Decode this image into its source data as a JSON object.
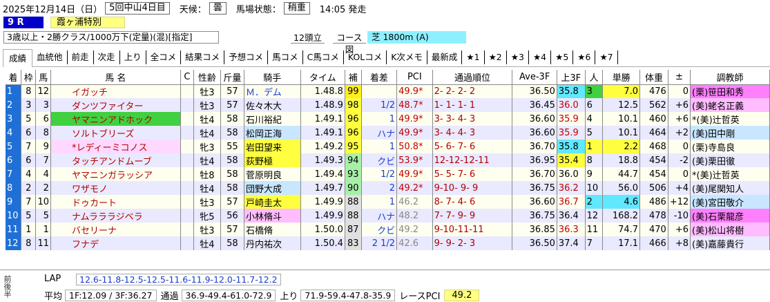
{
  "info": {
    "date": "2025年12月14日（日）",
    "meeting": "5回中山4日目",
    "weather_label": "天候：",
    "weather": "曇",
    "track_label": "馬場状態：",
    "track": "稍重",
    "start_time": "14:05 発走"
  },
  "race": {
    "number": "9 R",
    "name": "霞ヶ浦特別",
    "conditions": "3歳以上・2勝クラス/1000万下(定量)(混)[指定]",
    "heads": "12頭立",
    "course_label": "コース図",
    "course": "芝 1800m (A)"
  },
  "tabs": [
    "成績",
    "血統他",
    "前走",
    "次走",
    "上り",
    "全コメ",
    "結果コメ",
    "予想コメ",
    "馬コメ",
    "C馬コメ",
    "KOLコメ",
    "K次メモ",
    "最新成",
    "★1",
    "★2",
    "★3",
    "★4",
    "★5",
    "★6",
    "★7"
  ],
  "columns": [
    "着",
    "枠",
    "馬",
    "馬 名",
    "C",
    "性齢",
    "斤量",
    "騎手",
    "タイム",
    "補",
    "着差",
    "PCI",
    "通過順位",
    "Ave-3F",
    "上3F",
    "人",
    "単勝",
    "体重",
    "±",
    "調教師"
  ],
  "rows": [
    {
      "rank": "1",
      "waku": "8",
      "num": "12",
      "mark": "",
      "name": "イガッチ",
      "c": "",
      "sex": "牡3",
      "kin": "57",
      "jockey": "Ｍ．デム",
      "time": "1.48.8",
      "ho": "99",
      "diff": "",
      "pci": "49.9*",
      "pass": "2- 2- 2- 2",
      "ave": "36.50",
      "agari": "35.8",
      "pop": "3",
      "odds": "7.0",
      "weight": "476",
      "pm": "0",
      "trainer": "(栗)笹田和秀"
    },
    {
      "rank": "2",
      "waku": "3",
      "num": "3",
      "mark": "",
      "name": "ダンツファイター",
      "c": "",
      "sex": "牡3",
      "kin": "57",
      "jockey": "佐々木大",
      "time": "1.48.9",
      "ho": "98",
      "diff": "1/2",
      "pci": "48.7*",
      "pass": "1- 1- 1- 1",
      "ave": "36.45",
      "agari": "36.0",
      "pop": "6",
      "odds": "12.5",
      "weight": "562",
      "pm": "+6",
      "trainer": "(美)蛯名正義"
    },
    {
      "rank": "3",
      "waku": "5",
      "num": "6",
      "mark": "",
      "name": "ヤマニンアドホック",
      "c": "",
      "sex": "牡4",
      "kin": "58",
      "jockey": "石川裕紀",
      "time": "1.49.1",
      "ho": "96",
      "diff": "1",
      "pci": "49.9*",
      "pass": "3- 3- 4- 3",
      "ave": "36.60",
      "agari": "35.9",
      "pop": "4",
      "odds": "10.1",
      "weight": "460",
      "pm": "+6",
      "trainer": "*(美)辻哲英"
    },
    {
      "rank": "4",
      "waku": "6",
      "num": "8",
      "mark": "",
      "name": "ソルトブリーズ",
      "c": "",
      "sex": "牡4",
      "kin": "58",
      "jockey": "松岡正海",
      "time": "1.49.1",
      "ho": "96",
      "diff": "ハナ",
      "pci": "49.9*",
      "pass": "3- 4- 4- 3",
      "ave": "36.60",
      "agari": "35.9",
      "pop": "5",
      "odds": "10.1",
      "weight": "464",
      "pm": "+2",
      "trainer": "(美)田中剛"
    },
    {
      "rank": "5",
      "waku": "7",
      "num": "9",
      "mark": "*",
      "name": "レディーミコノス",
      "c": "",
      "sex": "牝3",
      "kin": "55",
      "jockey": "岩田望来",
      "time": "1.49.2",
      "ho": "95",
      "diff": "1",
      "pci": "50.8*",
      "pass": "5- 6- 7- 6",
      "ave": "36.70",
      "agari": "35.8",
      "pop": "1",
      "odds": "2.2",
      "weight": "468",
      "pm": "0",
      "trainer": "(栗)寺島良"
    },
    {
      "rank": "6",
      "waku": "6",
      "num": "7",
      "mark": "",
      "name": "タッチアンドムーブ",
      "c": "",
      "sex": "牡4",
      "kin": "58",
      "jockey": "荻野極",
      "time": "1.49.3",
      "ho": "94",
      "diff": "クビ",
      "pci": "53.9*",
      "pass": "12-12-12-11",
      "ave": "36.95",
      "agari": "35.4",
      "pop": "8",
      "odds": "18.8",
      "weight": "454",
      "pm": "-2",
      "trainer": "(美)栗田徹"
    },
    {
      "rank": "7",
      "waku": "4",
      "num": "4",
      "mark": "",
      "name": "ヤマニンガラッシア",
      "c": "",
      "sex": "牡8",
      "kin": "58",
      "jockey": "菅原明良",
      "time": "1.49.4",
      "ho": "93",
      "diff": "1/2",
      "pci": "49.9*",
      "pass": "5- 5- 7- 6",
      "ave": "36.70",
      "agari": "36.0",
      "pop": "9",
      "odds": "44.7",
      "weight": "454",
      "pm": "0",
      "trainer": "*(美)辻哲英"
    },
    {
      "rank": "8",
      "waku": "2",
      "num": "2",
      "mark": "",
      "name": "ワザモノ",
      "c": "",
      "sex": "牡4",
      "kin": "58",
      "jockey": "団野大成",
      "time": "1.49.7",
      "ho": "90",
      "diff": "2",
      "pci": "49.2*",
      "pass": "9-10- 9- 9",
      "ave": "36.75",
      "agari": "36.2",
      "pop": "10",
      "odds": "56.0",
      "weight": "506",
      "pm": "+4",
      "trainer": "(美)尾関知人"
    },
    {
      "rank": "9",
      "waku": "7",
      "num": "10",
      "mark": "",
      "name": "ドゥカート",
      "c": "",
      "sex": "牡3",
      "kin": "57",
      "jockey": "戸崎圭太",
      "time": "1.49.9",
      "ho": "88",
      "diff": "1",
      "pci": "46.2",
      "pass": "8- 7- 4- 6",
      "ave": "36.60",
      "agari": "36.7",
      "pop": "2",
      "odds": "4.6",
      "weight": "486",
      "pm": "+12",
      "trainer": "(美)宮田敬介"
    },
    {
      "rank": "10",
      "waku": "5",
      "num": "5",
      "mark": "",
      "name": "ナムラララジベラ",
      "c": "",
      "sex": "牝5",
      "kin": "56",
      "jockey": "小林脩斗",
      "time": "1.49.9",
      "ho": "88",
      "diff": "ハナ",
      "pci": "48.2",
      "pass": "7- 7- 9- 9",
      "ave": "36.75",
      "agari": "36.4",
      "pop": "12",
      "odds": "168.2",
      "weight": "478",
      "pm": "-10",
      "trainer": "(美)石栗龍彦"
    },
    {
      "rank": "11",
      "waku": "1",
      "num": "1",
      "mark": "",
      "name": "バセリーナ",
      "c": "",
      "sex": "牡3",
      "kin": "57",
      "jockey": "石橋脩",
      "time": "1.50.0",
      "ho": "87",
      "diff": "クビ",
      "pci": "49.2",
      "pass": "9-10-11-11",
      "ave": "36.85",
      "agari": "36.3",
      "pop": "11",
      "odds": "74.7",
      "weight": "470",
      "pm": "+6",
      "trainer": "(美)松山将樹"
    },
    {
      "rank": "12",
      "waku": "8",
      "num": "11",
      "mark": "",
      "name": "フナデ",
      "c": "",
      "sex": "牡4",
      "kin": "58",
      "jockey": "丹内祐次",
      "time": "1.50.4",
      "ho": "83",
      "diff": "2 1/2",
      "pci": "42.6",
      "pass": "9- 9- 2- 3",
      "ave": "36.50",
      "agari": "37.4",
      "pop": "7",
      "odds": "17.1",
      "weight": "466",
      "pm": "+8",
      "trainer": "(美)嘉藤貴行"
    }
  ],
  "laps": {
    "side_label": "前後半",
    "lap_label": "LAP",
    "lap_values": "12.6-11.8-12.5-12.5-11.6-11.9-12.0-11.7-12.2",
    "avg_label": "平均",
    "avg_value": "1F:12.09 / 3F:36.27",
    "pass_label": "通過",
    "pass_value": "36.9-49.4-61.0-72.9",
    "agari_label": "上り",
    "agari_value": "71.9-59.4-47.8-35.9",
    "pci_label": "レースPCI",
    "pci_value": "49.2"
  },
  "colors": {
    "rank_bg": "#1f6fd6",
    "race_no_bg": "#0000c8",
    "race_name_bg": "#ffff80",
    "course_bg": "#8ef0ff",
    "row_even": "#e9e9ff",
    "row_odd": "#fffff0"
  }
}
